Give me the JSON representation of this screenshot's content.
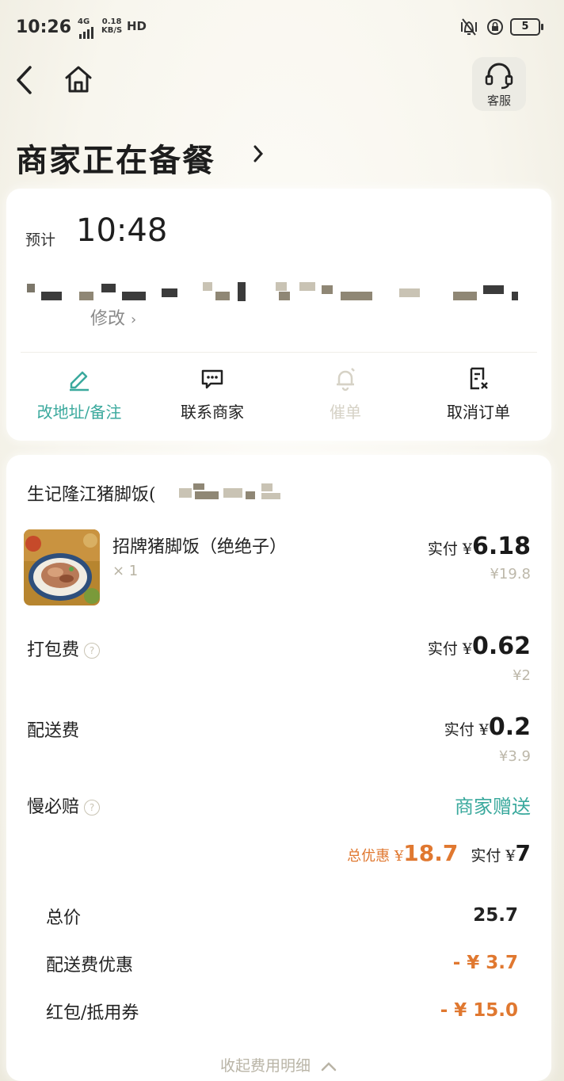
{
  "status_bar": {
    "time": "10:26",
    "network": "4G",
    "speed_value": "0.18",
    "speed_unit": "KB/S",
    "hd": "HD",
    "battery": "5"
  },
  "header": {
    "support_label": "客服"
  },
  "order_status": {
    "title": "商家正在备餐"
  },
  "delivery": {
    "eta_label": "预计",
    "eta_time": "10:48",
    "modify_label": "修改"
  },
  "actions": [
    {
      "label": "改地址/备注",
      "icon": "edit-icon"
    },
    {
      "label": "联系商家",
      "icon": "chat-icon"
    },
    {
      "label": "催单",
      "icon": "bell-icon"
    },
    {
      "label": "取消订单",
      "icon": "cancel-doc-icon"
    }
  ],
  "order": {
    "shop_name": "生记隆江猪脚饭(",
    "item": {
      "name": "招牌猪脚饭（绝绝子）",
      "qty": "× 1",
      "paid_prefix": "实付 ¥",
      "paid": "6.18",
      "original": "¥19.8"
    },
    "packing": {
      "label": "打包费",
      "paid_prefix": "实付 ¥",
      "paid": "0.62",
      "original": "¥2"
    },
    "delivery_fee": {
      "label": "配送费",
      "paid_prefix": "实付 ¥",
      "paid": "0.2",
      "original": "¥3.9"
    },
    "late_comp": {
      "label": "慢必赔",
      "value": "商家赠送"
    },
    "summary": {
      "discount_label": "总优惠 ¥",
      "discount": "18.7",
      "paid_label": "实付 ¥",
      "paid": "7"
    },
    "details": [
      {
        "label": "总价",
        "value": "25.7"
      },
      {
        "label": "配送费优惠",
        "value": "- ¥ 3.7"
      },
      {
        "label": "红包/抵用券",
        "value": "- ¥ 15.0"
      }
    ],
    "collapse_label": "收起费用明细"
  },
  "colors": {
    "accent_teal": "#3aa99d",
    "discount_orange": "#e07830"
  }
}
